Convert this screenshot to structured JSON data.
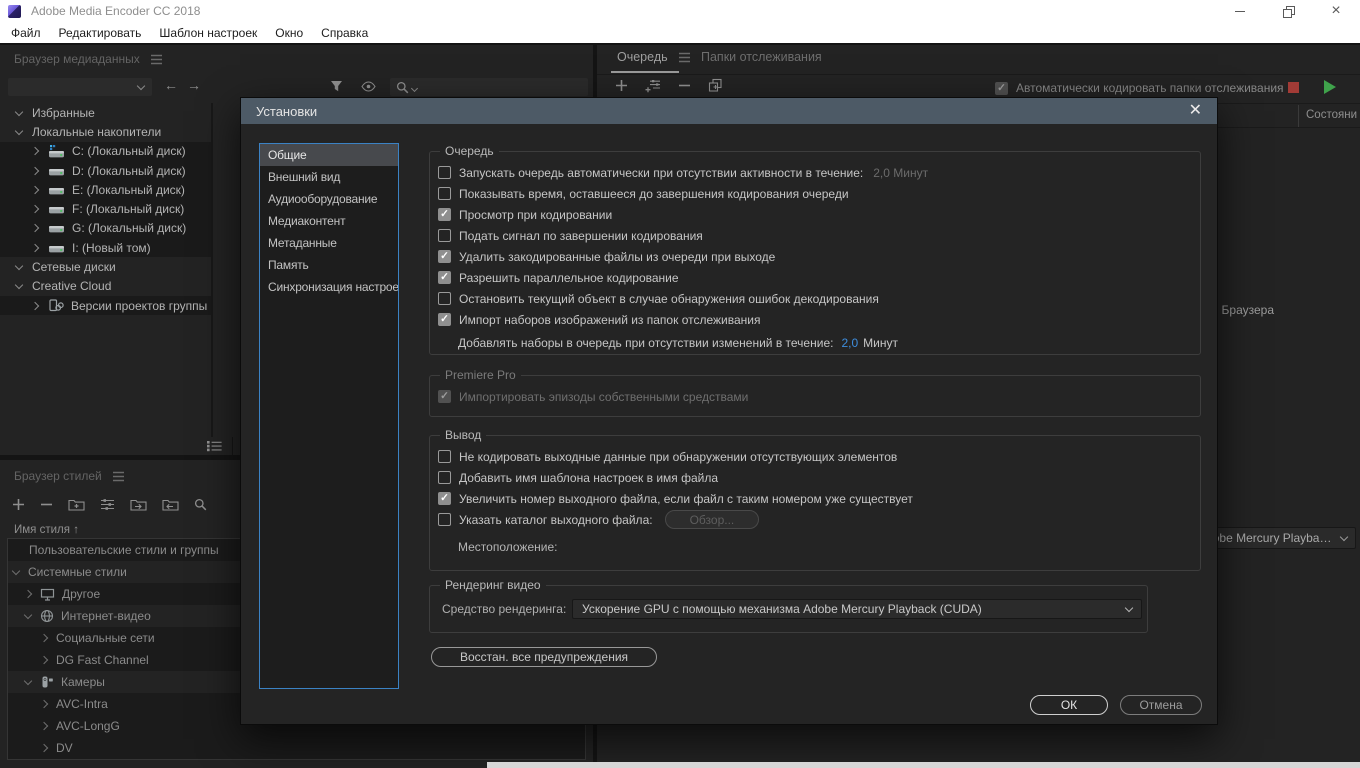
{
  "window": {
    "title": "Adobe Media Encoder CC 2018",
    "menu": [
      "Файл",
      "Редактировать",
      "Шаблон настроек",
      "Окно",
      "Справка"
    ]
  },
  "media_browser": {
    "title": "Браузер медиаданных",
    "location_dropdown_value": "",
    "toolbar_icon_names": [
      "funnel-icon",
      "eye-icon",
      "search-icon"
    ],
    "tree": [
      {
        "label": "Избранные",
        "level": 0,
        "chevron": "down",
        "icon": null,
        "stripe": false
      },
      {
        "label": "Локальные накопители",
        "level": 0,
        "chevron": "down",
        "icon": null,
        "stripe": false
      },
      {
        "label": "C: (Локальный диск)",
        "level": 1,
        "chevron": "right",
        "icon": "drive-shared",
        "stripe": true
      },
      {
        "label": "D: (Локальный диск)",
        "level": 1,
        "chevron": "right",
        "icon": "drive",
        "stripe": true
      },
      {
        "label": "E: (Локальный диск)",
        "level": 1,
        "chevron": "right",
        "icon": "drive",
        "stripe": true
      },
      {
        "label": "F: (Локальный диск)",
        "level": 1,
        "chevron": "right",
        "icon": "drive",
        "stripe": true
      },
      {
        "label": "G: (Локальный диск)",
        "level": 1,
        "chevron": "right",
        "icon": "drive",
        "stripe": true
      },
      {
        "label": "I: (Новый том)",
        "level": 1,
        "chevron": "right",
        "icon": "drive",
        "stripe": true
      },
      {
        "label": "Сетевые диски",
        "level": 0,
        "chevron": "down",
        "icon": null,
        "stripe": false
      },
      {
        "label": "Creative Cloud",
        "level": 0,
        "chevron": "down",
        "icon": null,
        "stripe": false
      },
      {
        "label": "Версии проектов группы",
        "level": 1,
        "chevron": "right",
        "icon": "team-projects",
        "stripe": true
      }
    ]
  },
  "preset_browser": {
    "title": "Браузер стилей",
    "column_header": "Имя стиля",
    "toolbar_icons": [
      "add",
      "remove",
      "new-group",
      "settings",
      "import",
      "export",
      "search"
    ],
    "rows": [
      {
        "label": "Пользовательские стили и группы",
        "pad": 21,
        "chevron": null,
        "icon": null,
        "stripe": true
      },
      {
        "label": "Системные стили",
        "pad": 5,
        "chevron": "down",
        "icon": null,
        "stripe": false
      },
      {
        "label": "Другое",
        "pad": 17,
        "chevron": "right",
        "icon": "monitor",
        "stripe": true
      },
      {
        "label": "Интернет-видео",
        "pad": 17,
        "chevron": "down",
        "icon": "globe",
        "stripe": false
      },
      {
        "label": "Социальные сети",
        "pad": 33,
        "chevron": "right",
        "icon": null,
        "stripe": true
      },
      {
        "label": "DG Fast Channel",
        "pad": 33,
        "chevron": "right",
        "icon": null,
        "stripe": true
      },
      {
        "label": "Камеры",
        "pad": 17,
        "chevron": "down",
        "icon": "camera",
        "stripe": false
      },
      {
        "label": "AVC-Intra",
        "pad": 33,
        "chevron": "right",
        "icon": null,
        "stripe": true
      },
      {
        "label": "AVC-LongG",
        "pad": 33,
        "chevron": "right",
        "icon": null,
        "stripe": true
      },
      {
        "label": "DV",
        "pad": 33,
        "chevron": "right",
        "icon": null,
        "stripe": true
      }
    ]
  },
  "queue_panel": {
    "tab_queue": "Очередь",
    "tab_watch": "Папки отслеживания",
    "toolbar_icons": [
      "add",
      "add-output",
      "remove",
      "duplicate"
    ],
    "auto_encode_label": "Автоматически кодировать папки отслеживания",
    "auto_encode_checked": true,
    "status_column": "Состояни",
    "hint_fragment": "из Браузера",
    "renderer_value": "Ускорение GPU с помощью механизма Adobe Mercury Playback (CUDA)"
  },
  "dialog": {
    "title": "Установки",
    "categories": [
      "Общие",
      "Внешний вид",
      "Аудиооборудование",
      "Медиаконтент",
      "Метаданные",
      "Память",
      "Синхронизация настроек"
    ],
    "selected_index": 0,
    "queue_group": {
      "legend": "Очередь",
      "items": [
        {
          "checked": false,
          "label": "Запускать очередь автоматически при отсутствии активности в течение:",
          "suffix": "2,0 Минут"
        },
        {
          "checked": false,
          "label": "Показывать время, оставшееся до завершения кодирования очереди"
        },
        {
          "checked": true,
          "label": "Просмотр при кодировании"
        },
        {
          "checked": false,
          "label": "Подать сигнал по завершении кодирования"
        },
        {
          "checked": true,
          "label": "Удалить закодированные файлы из очереди при выходе"
        },
        {
          "checked": true,
          "label": "Разрешить параллельное кодирование"
        },
        {
          "checked": false,
          "label": "Остановить текущий объект в случае обнаружения ошибок декодирования"
        },
        {
          "checked": true,
          "label": "Импорт наборов изображений из папок отслеживания"
        }
      ],
      "sub_row": {
        "label": "Добавлять наборы в очередь при отсутствии изменений в течение:",
        "value": "2,0",
        "unit": "Минут"
      }
    },
    "premiere_group": {
      "legend": "Premiere Pro",
      "items": [
        {
          "checked": true,
          "disabled": true,
          "label": "Импортировать эпизоды собственными средствами"
        }
      ]
    },
    "output_group": {
      "legend": "Вывод",
      "items": [
        {
          "checked": false,
          "label": "Не кодировать выходные данные при обнаружении отсутствующих элементов"
        },
        {
          "checked": false,
          "label": "Добавить имя шаблона настроек в имя файла"
        },
        {
          "checked": true,
          "label": "Увеличить номер выходного файла, если файл с таким номером уже существует"
        },
        {
          "checked": false,
          "label": "Указать каталог выходного файла:",
          "button": "Обзор..."
        }
      ],
      "location_label": "Местоположение:"
    },
    "render_group": {
      "legend": "Рендеринг видео",
      "renderer_label": "Средство рендеринга:",
      "renderer_value": "Ускорение GPU с помощью механизма Adobe Mercury Playback (CUDA)"
    },
    "reset_button": "Восстан. все предупреждения",
    "ok": "ОК",
    "cancel": "Отмена"
  },
  "colors": {
    "accent_blue": "#3e8ede",
    "dialog_titlebar": "#4d5a66",
    "focus_border": "#3b82c4",
    "stop_red": "#a23b36",
    "play_green": "#3fa24b"
  }
}
